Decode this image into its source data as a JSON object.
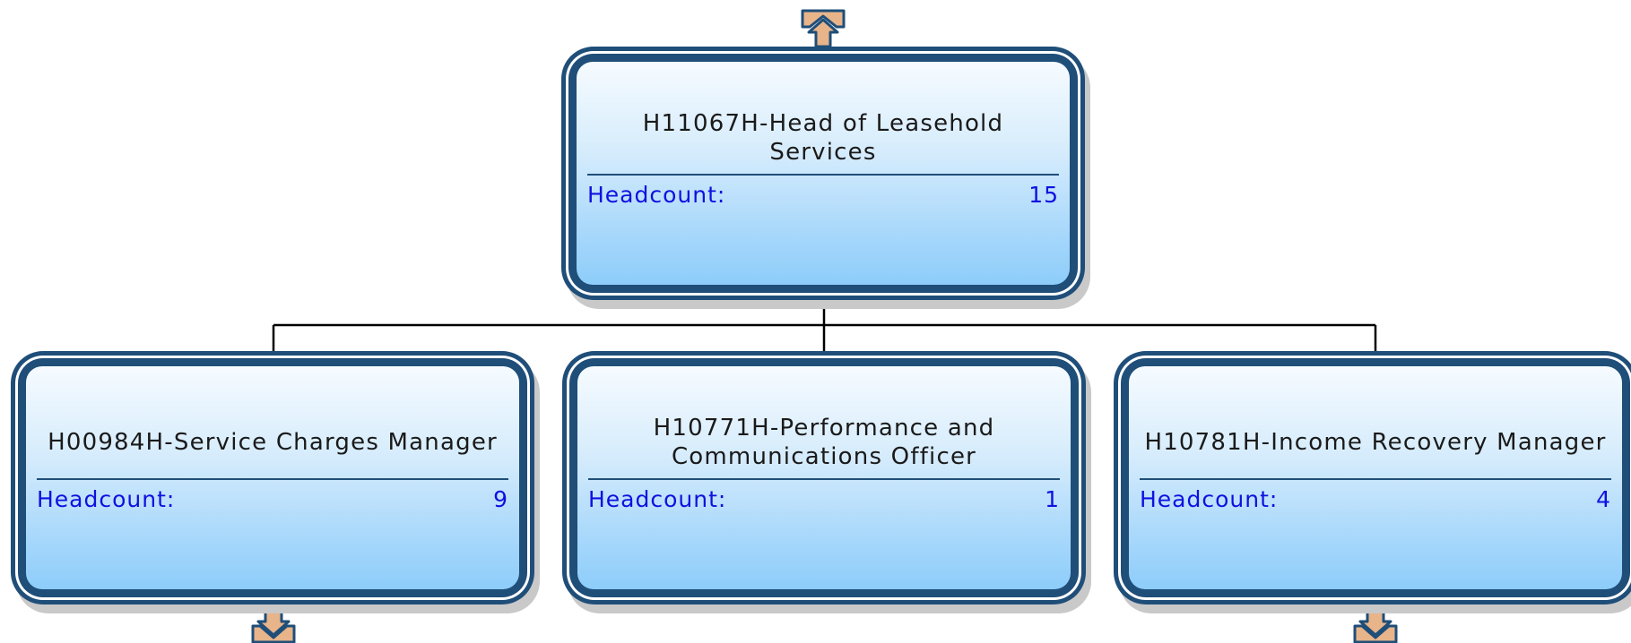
{
  "colors": {
    "border": "#1f4e79",
    "gradient_top": "#f6fbff",
    "gradient_bottom": "#8dcdfa",
    "headcount_text": "#1010e0",
    "title_text": "#1a1a1a",
    "arrow_fill": "#e8b48a",
    "connector": "#000000"
  },
  "root": {
    "title": "H11067H-Head of Leasehold Services",
    "headcount_label": "Headcount:",
    "headcount_value": "15",
    "has_parent_arrow": true
  },
  "children": [
    {
      "title": "H00984H-Service Charges Manager",
      "headcount_label": "Headcount:",
      "headcount_value": "9",
      "has_children_arrow": true
    },
    {
      "title": "H10771H-Performance and Communications Officer",
      "headcount_label": "Headcount:",
      "headcount_value": "1",
      "has_children_arrow": false
    },
    {
      "title": "H10781H-Income Recovery Manager",
      "headcount_label": "Headcount:",
      "headcount_value": "4",
      "has_children_arrow": true
    }
  ]
}
